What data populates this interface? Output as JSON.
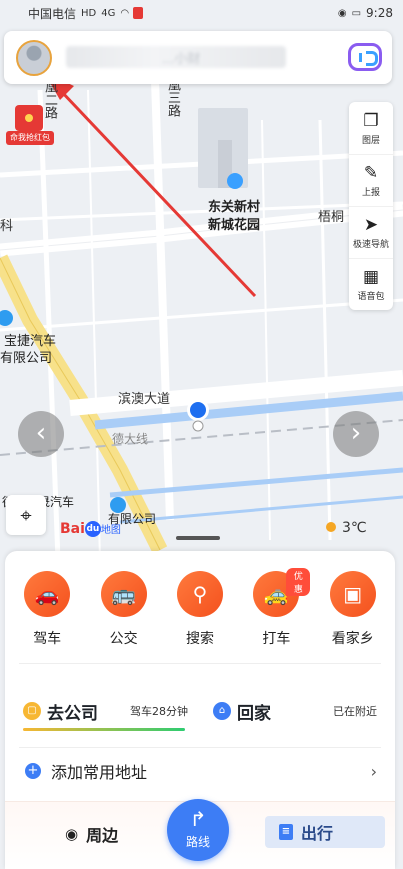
{
  "status_bar": {
    "carrier": "中国电信",
    "hd": "HD",
    "net": "4G",
    "time": "9:28"
  },
  "search": {
    "placeholder": "...小财",
    "voice_icon": "voice-assistant-icon"
  },
  "red_packet": {
    "label": "命我抢红包"
  },
  "map_labels": {
    "road_n": "凰三路",
    "road_w": "凰二路",
    "poi_name_1": "东关新村",
    "poi_name_2": "新城花园",
    "road_e": "梧桐",
    "left_cut": "科",
    "porsche_1": "宝捷汽车",
    "porsche_2": "有限公司",
    "main_road": "滨澳大道",
    "rail": "德大线",
    "dealer_1": "德州首晟汽车",
    "dealer_2": "有限公司"
  },
  "tools": [
    {
      "icon": "layers-icon",
      "label": "图层"
    },
    {
      "icon": "report-icon",
      "label": "上报"
    },
    {
      "icon": "fast-nav-icon",
      "label": "极速导航"
    },
    {
      "icon": "voice-pack-icon",
      "label": "语音包"
    }
  ],
  "brand": {
    "bai": "Bai",
    "du": "du",
    "ditu": "地图"
  },
  "weather": {
    "temp": "3℃"
  },
  "quick_actions": [
    {
      "icon": "car-icon",
      "label": "驾车"
    },
    {
      "icon": "bus-icon",
      "label": "公交"
    },
    {
      "icon": "search-icon",
      "label": "搜索"
    },
    {
      "icon": "taxi-icon",
      "label": "打车",
      "badge": "优惠"
    },
    {
      "icon": "home-view-icon",
      "label": "看家乡"
    }
  ],
  "to_company": {
    "title": "去公司",
    "sub": "驾车28分钟"
  },
  "go_home": {
    "title": "回家",
    "sub": "已在附近"
  },
  "add_address": {
    "label": "添加常用地址"
  },
  "bottom_bar": {
    "nearby": "周边",
    "route": "路线",
    "travel": "出行"
  },
  "colors": {
    "accent_blue": "#3d7df5",
    "action_orange": "#f4511e",
    "arrow_red": "#e53935"
  }
}
